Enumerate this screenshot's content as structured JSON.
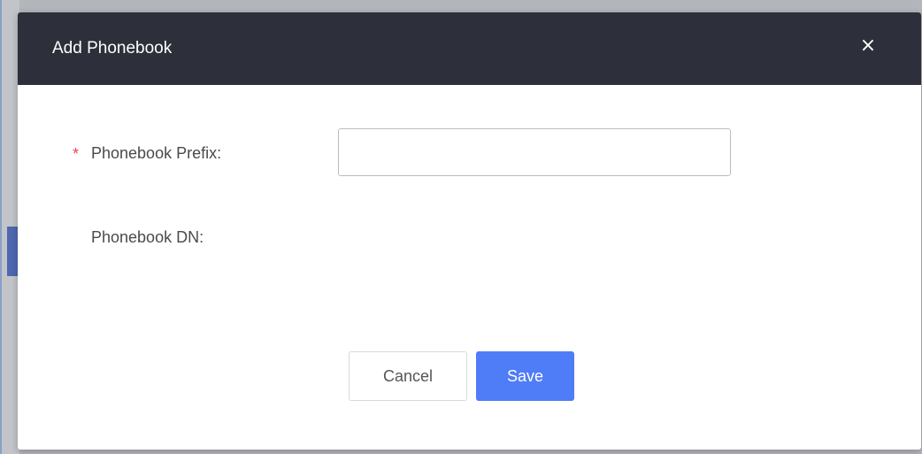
{
  "modal": {
    "title": "Add Phonebook",
    "close_glyph": "×",
    "colors": {
      "header_bg": "#2d303a",
      "primary": "#4f7cf7",
      "required": "#f04848"
    }
  },
  "form": {
    "prefix": {
      "required_mark": "*",
      "label": "Phonebook Prefix:",
      "value": "",
      "placeholder": ""
    },
    "dn": {
      "label": "Phonebook DN:"
    }
  },
  "actions": {
    "cancel_label": "Cancel",
    "save_label": "Save"
  },
  "icons": {
    "close": "close-icon"
  }
}
